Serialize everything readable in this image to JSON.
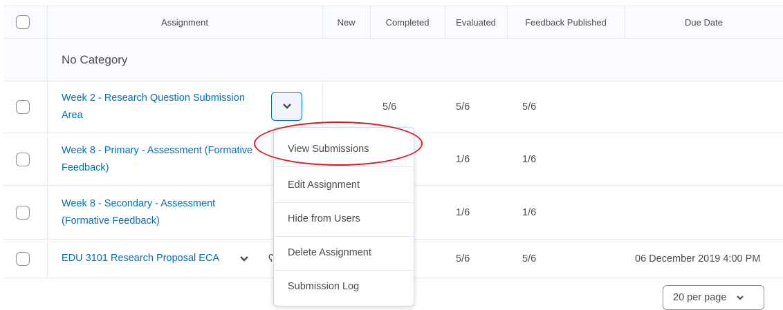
{
  "columns": {
    "assignment": "Assignment",
    "new": "New",
    "completed": "Completed",
    "evaluated": "Evaluated",
    "feedback_published": "Feedback Published",
    "due_date": "Due Date"
  },
  "category": "No Category",
  "rows": [
    {
      "line1": "Week 2 - Research Question Submission",
      "line2": "Area",
      "new": "",
      "completed": "5/6",
      "evaluated": "5/6",
      "feedback": "5/6",
      "due": ""
    },
    {
      "line1": "Week 8 - Primary - Assessment (Formative",
      "line2": "Feedback)",
      "new": "",
      "completed": "",
      "evaluated": "1/6",
      "feedback": "1/6",
      "due": ""
    },
    {
      "line1": "Week 8 - Secondary - Assessment",
      "line2": "(Formative Feedback)",
      "new": "",
      "completed": "",
      "evaluated": "1/6",
      "feedback": "1/6",
      "due": ""
    },
    {
      "line1": "EDU 3101 Research Proposal ECA",
      "line2": "",
      "new": "",
      "completed": "",
      "evaluated": "5/6",
      "feedback": "5/6",
      "due": "06 December 2019 4:00 PM"
    }
  ],
  "context_menu": {
    "items": [
      "View Submissions",
      "Edit Assignment",
      "Hide from Users",
      "Delete Assignment",
      "Submission Log"
    ]
  },
  "pager": {
    "label": "20 per page"
  },
  "colors": {
    "link": "#006fbf",
    "annotation": "#e0141e",
    "header_bg": "#f9fbff"
  },
  "icons": [
    "chevron-down-icon",
    "checkbox",
    "partial-key-icon"
  ]
}
